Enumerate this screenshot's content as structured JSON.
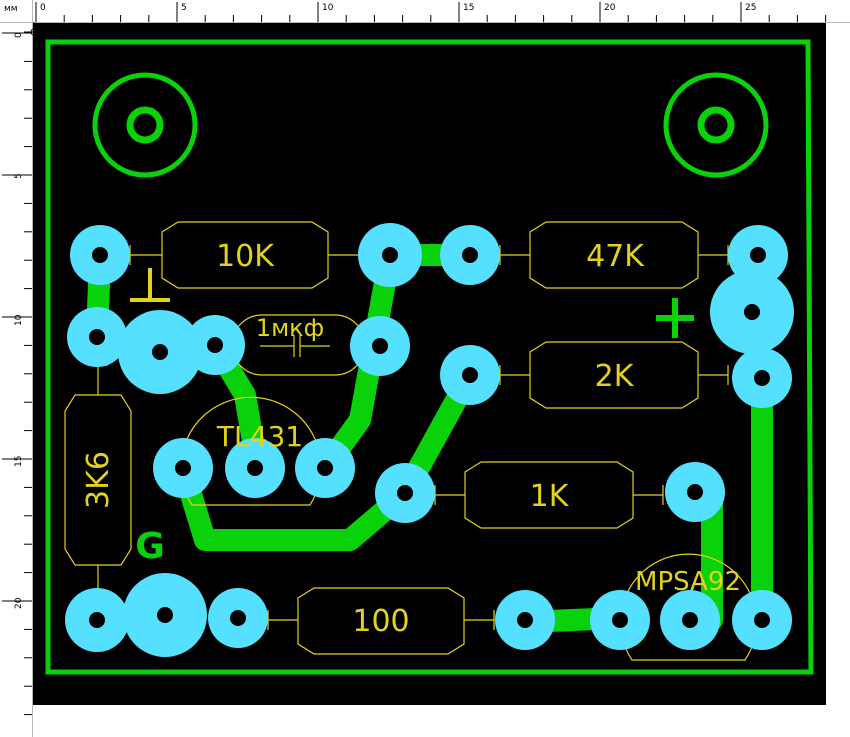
{
  "ruler": {
    "unit": "мм",
    "top_labels": [
      "0",
      "5",
      "10",
      "15",
      "20",
      "25"
    ],
    "left_labels": [
      "0",
      "5",
      "10",
      "15",
      "20"
    ]
  },
  "labels": {
    "r_10k": "10K",
    "r_47k": "47K",
    "r_2k": "2K",
    "r_1k": "1K",
    "r_100": "100",
    "r_3k6": "3K6",
    "cap": "1мкф",
    "tl431": "TL431",
    "mpsa92": "MPSA92",
    "gnd": "G"
  },
  "colors": {
    "board": "#000000",
    "copper": "#0ad20a",
    "pad": "#55e0ff",
    "silk": "#e3d21c"
  }
}
